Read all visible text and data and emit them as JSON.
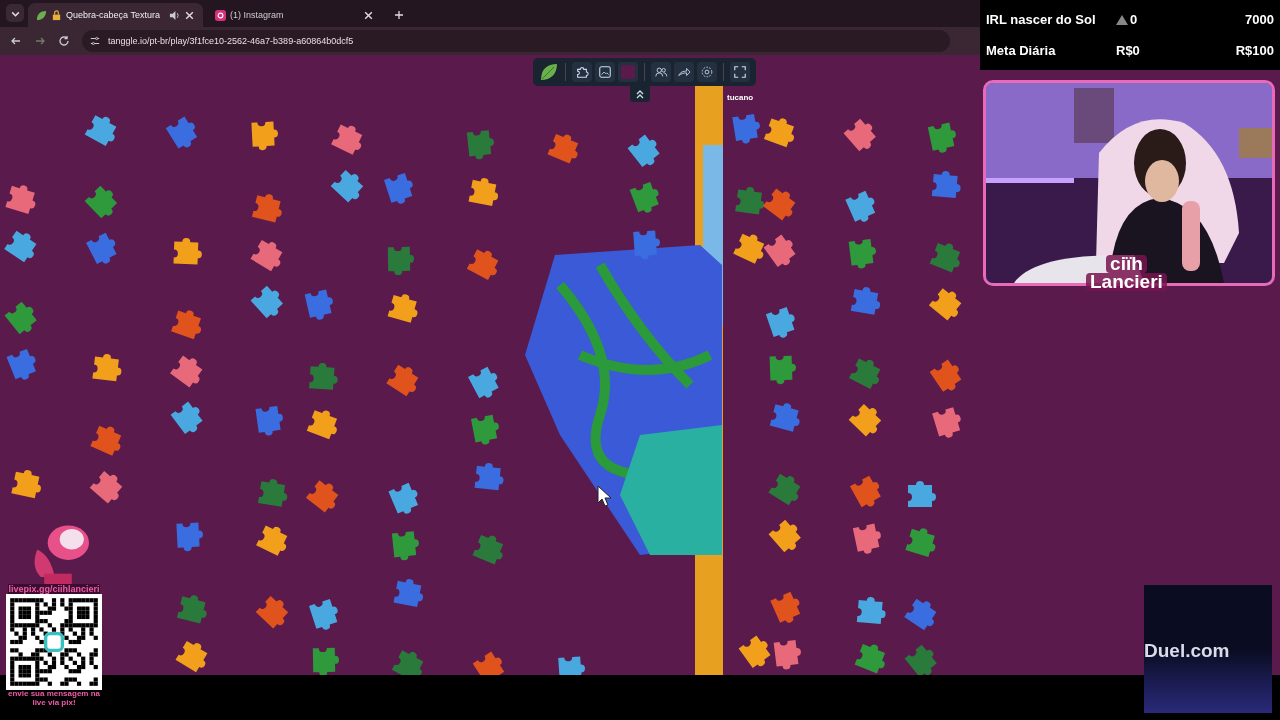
{
  "browser": {
    "tabs": [
      {
        "title": "Quebra-cabeça Textura",
        "selected": true,
        "audio": true
      },
      {
        "title": "(1) Instagram",
        "selected": false,
        "audio": false
      }
    ],
    "url": "tanggle.io/pt-br/play/3f1fce10-2562-46a7-b389-a60864b0dcf5"
  },
  "game": {
    "player_label": "tucano"
  },
  "overlay": {
    "goals": [
      {
        "label": "IRL nascer do Sol",
        "kind": "count",
        "current": "0",
        "target": "7000"
      },
      {
        "label": "Meta Diária",
        "kind": "money",
        "current": "R$0",
        "target": "R$100"
      }
    ],
    "cam_name": [
      "ciïh",
      "Lancieri"
    ],
    "qr": {
      "link": "livepix.gg/ciihlancieri",
      "caption": "envie sua mensagem na live via pix!"
    },
    "sponsor": "Duel.com"
  }
}
